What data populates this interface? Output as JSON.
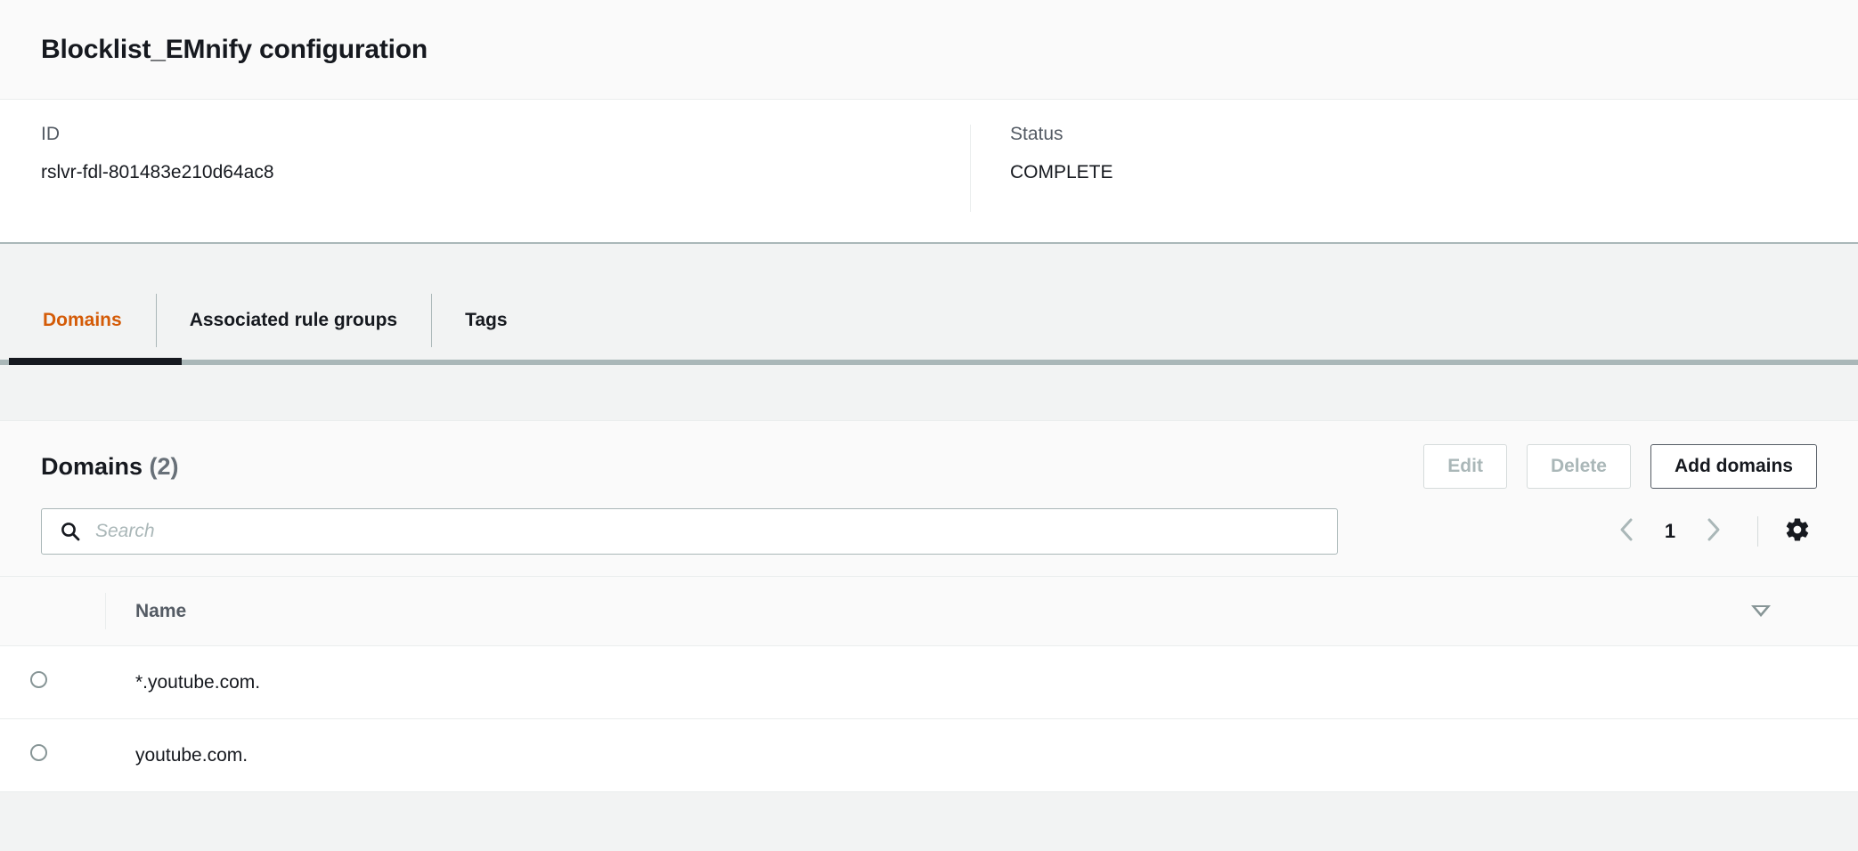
{
  "detail": {
    "title": "Blocklist_EMnify configuration",
    "fields": [
      {
        "label": "ID",
        "value": "rslvr-fdl-801483e210d64ac8"
      },
      {
        "label": "Status",
        "value": "COMPLETE"
      }
    ]
  },
  "tabs": [
    {
      "label": "Domains",
      "active": true
    },
    {
      "label": "Associated rule groups",
      "active": false
    },
    {
      "label": "Tags",
      "active": false
    }
  ],
  "domains_panel": {
    "title": "Domains",
    "count": "(2)",
    "buttons": {
      "edit": "Edit",
      "delete": "Delete",
      "add": "Add domains"
    },
    "search": {
      "placeholder": "Search",
      "value": "",
      "icon": "search-icon"
    },
    "pagination": {
      "prev_icon": "chevron-left-icon",
      "page": "1",
      "next_icon": "chevron-right-icon",
      "settings_icon": "gear-icon"
    },
    "table": {
      "columns": [
        "",
        "Name",
        ""
      ],
      "sort_icon": "sort-descending-triangle-icon",
      "rows": [
        {
          "name": "*.youtube.com."
        },
        {
          "name": "youtube.com."
        }
      ]
    }
  },
  "colors": {
    "accent_orange": "#d45b07",
    "text_dark": "#16191f",
    "text_muted": "#545b64",
    "disabled": "#aab7b8",
    "page_bg": "#f2f3f3"
  }
}
